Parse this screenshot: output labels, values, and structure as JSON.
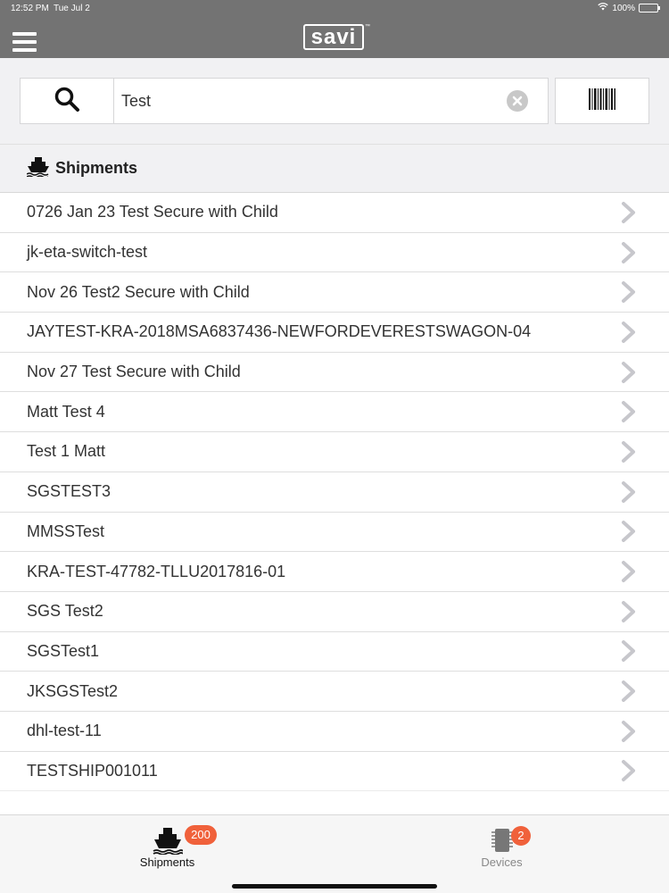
{
  "status_bar": {
    "time": "12:52 PM",
    "date": "Tue Jul 2",
    "battery": "100%"
  },
  "header": {
    "logo": "savi",
    "logo_tm": "™"
  },
  "search": {
    "query": "Test",
    "placeholder": ""
  },
  "section": {
    "title": "Shipments",
    "icon": "ship-icon"
  },
  "shipments": [
    {
      "label": "0726 Jan 23 Test Secure with Child"
    },
    {
      "label": "jk-eta-switch-test"
    },
    {
      "label": "Nov 26 Test2 Secure with Child"
    },
    {
      "label": "JAYTEST-KRA-2018MSA6837436-NEWFORDEVERESTSWAGON-04"
    },
    {
      "label": "Nov 27 Test Secure with Child"
    },
    {
      "label": "Matt Test 4"
    },
    {
      "label": "Test 1 Matt"
    },
    {
      "label": "SGSTEST3"
    },
    {
      "label": "MMSSTest"
    },
    {
      "label": "KRA-TEST-47782-TLLU2017816-01"
    },
    {
      "label": "SGS Test2"
    },
    {
      "label": "SGSTest1"
    },
    {
      "label": "JKSGSTest2"
    },
    {
      "label": "dhl-test-11"
    },
    {
      "label": "TESTSHIP001011"
    }
  ],
  "tabs": [
    {
      "label": "Shipments",
      "badge": "200",
      "icon": "ship-icon",
      "active": true
    },
    {
      "label": "Devices",
      "badge": "2",
      "icon": "chip-icon",
      "active": false
    }
  ],
  "colors": {
    "header": "#737373",
    "badge": "#f0613b",
    "background": "#f1f1f3"
  }
}
